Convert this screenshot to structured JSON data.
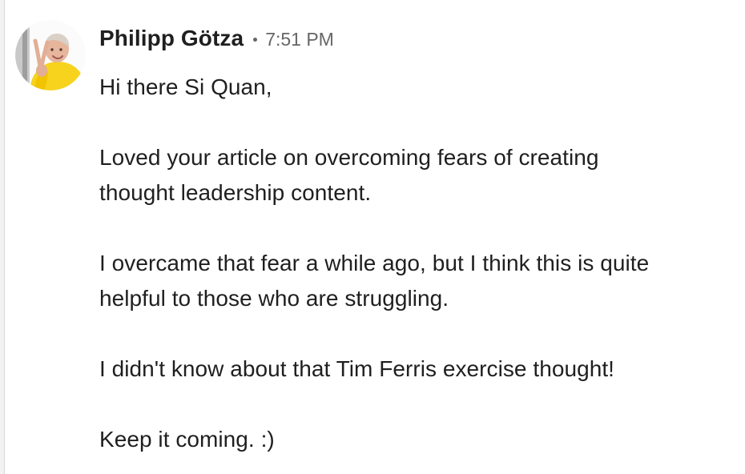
{
  "conversation": {
    "message": {
      "sender_name": "Philipp Götza",
      "timestamp": "7:51 PM",
      "avatar_icon": "person-avatar-icon",
      "body": [
        "Hi there Si Quan,",
        "Loved your article on overcoming fears of creating",
        "thought leadership content.",
        "I overcame that fear a while ago, but I think this is quite",
        "helpful to those who are struggling.",
        "I didn't know about that Tim Ferris exercise thought!",
        "Keep it coming. :)"
      ]
    }
  },
  "colors": {
    "text_primary": "#1f1f1f",
    "text_secondary": "#666666",
    "avatar_shirt": "#f7d31e",
    "background": "#ffffff"
  }
}
